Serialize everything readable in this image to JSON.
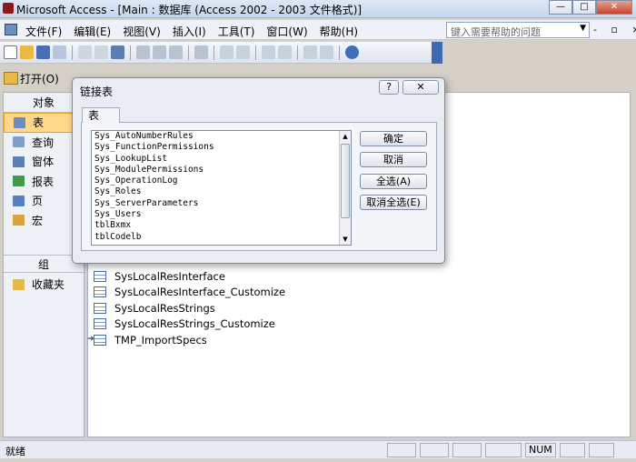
{
  "window": {
    "title": "Microsoft Access - [Main : 数据库 (Access 2002 - 2003 文件格式)]",
    "buttons": [
      "—",
      "□",
      "✕"
    ]
  },
  "menu": {
    "items": [
      "文件(F)",
      "编辑(E)",
      "视图(V)",
      "插入(I)",
      "工具(T)",
      "窗口(W)",
      "帮助(H)"
    ]
  },
  "help": {
    "placeholder": "键入需要帮助的问题"
  },
  "mdi_buttons": "- ▫ ×",
  "db_toolbar": {
    "open_label": "打开(O)"
  },
  "objects": {
    "header": "对象",
    "items": [
      "表",
      "查询",
      "窗体",
      "报表",
      "页",
      "宏"
    ],
    "group_header": "组",
    "favorites": "收藏夹"
  },
  "list": {
    "items": [
      "SysLocalResInterface",
      "SysLocalResInterface_Customize",
      "SysLocalResStrings",
      "SysLocalResStrings_Customize",
      "TMP_ImportSpecs"
    ]
  },
  "dialog": {
    "title": "链接表",
    "help_button": "?",
    "close_button": "✕",
    "tab": "表",
    "tables": [
      "Sys_AutoNumberRules",
      "Sys_FunctionPermissions",
      "Sys_LookupList",
      "Sys_ModulePermissions",
      "Sys_OperationLog",
      "Sys_Roles",
      "Sys_ServerParameters",
      "Sys_Users",
      "tblBxmx",
      "tblCodelb"
    ],
    "buttons": {
      "ok": "确定",
      "cancel": "取消",
      "select_all": "全选(A)",
      "deselect_all": "取消全选(E)"
    }
  },
  "status": {
    "text": "就绪",
    "num": "NUM"
  },
  "colors": {
    "accent": "#3d6ab3",
    "selected_object": "#ffd88a"
  }
}
